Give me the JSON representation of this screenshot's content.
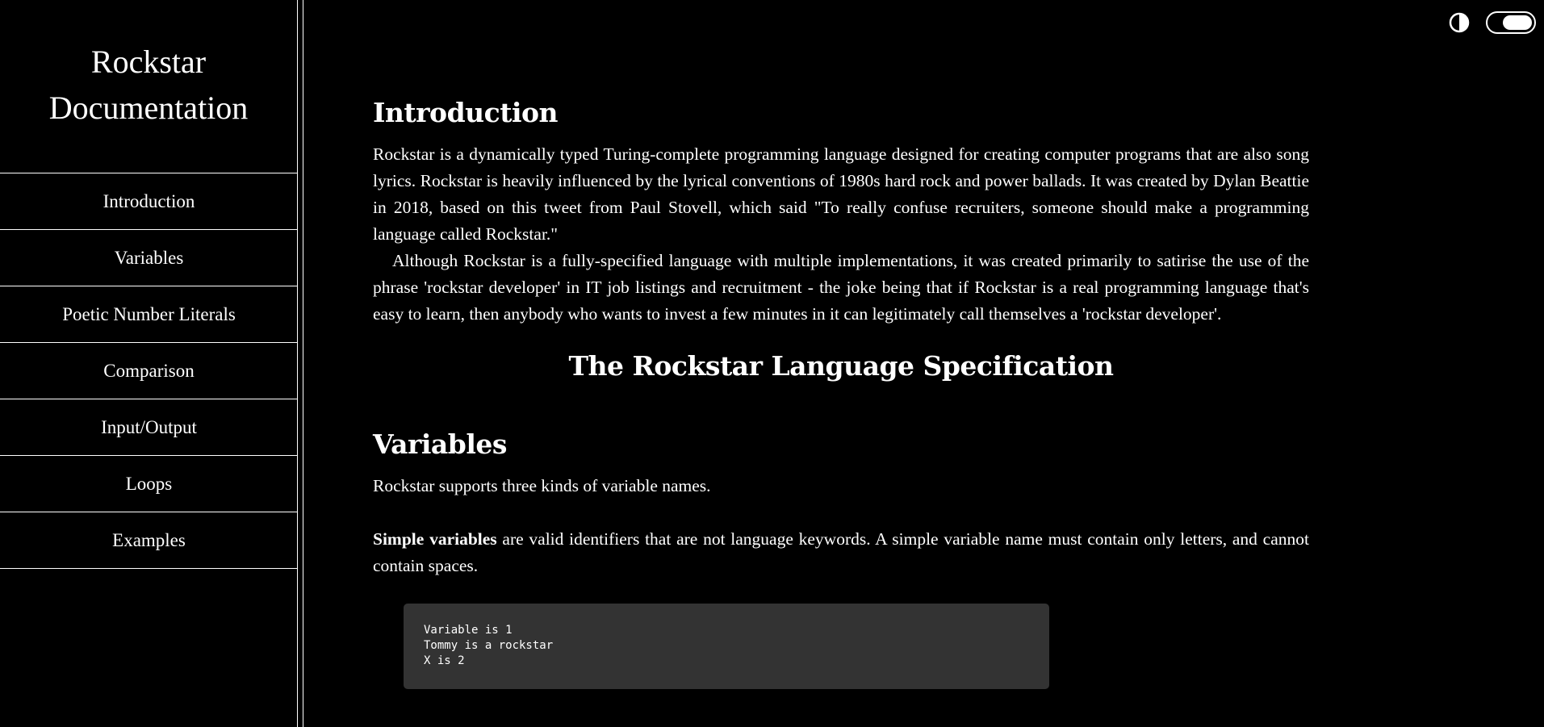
{
  "sidebar": {
    "title_line1": "Rockstar",
    "title_line2": "Documentation",
    "items": [
      {
        "label": "Introduction"
      },
      {
        "label": "Variables"
      },
      {
        "label": "Poetic Number Literals"
      },
      {
        "label": "Comparison"
      },
      {
        "label": "Input/Output"
      },
      {
        "label": "Loops"
      },
      {
        "label": "Examples"
      }
    ]
  },
  "topbar": {
    "contrast_icon": "contrast-icon",
    "theme_toggle_state": "on"
  },
  "intro": {
    "heading": "Introduction",
    "para1": "Rockstar is a dynamically typed Turing-complete programming language designed for creating computer programs that are also song lyrics. Rockstar is heavily influenced by the lyrical conventions of 1980s hard rock and power ballads. It was created by Dylan Beattie in 2018, based on this tweet from Paul Stovell, which said \"To really confuse recruiters, someone should make a programming language called Rockstar.\"",
    "para2": "Although Rockstar is a fully-specified language with multiple implementations, it was created primarily to satirise the use of the phrase 'rockstar developer' in IT job listings and recruitment - the joke being that if Rockstar is a real programming language that's easy to learn, then anybody who wants to invest a few minutes in it can legitimately call themselves a 'rockstar developer'."
  },
  "spec_heading": "The Rockstar Language Specification",
  "variables": {
    "heading": "Variables",
    "para1": "Rockstar supports three kinds of variable names.",
    "simple_bold": "Simple variables",
    "simple_rest": " are valid identifiers that are not language keywords. A simple variable name must contain only letters, and cannot contain spaces.",
    "code": "Variable is 1\nTommy is a rockstar\nX is 2"
  }
}
